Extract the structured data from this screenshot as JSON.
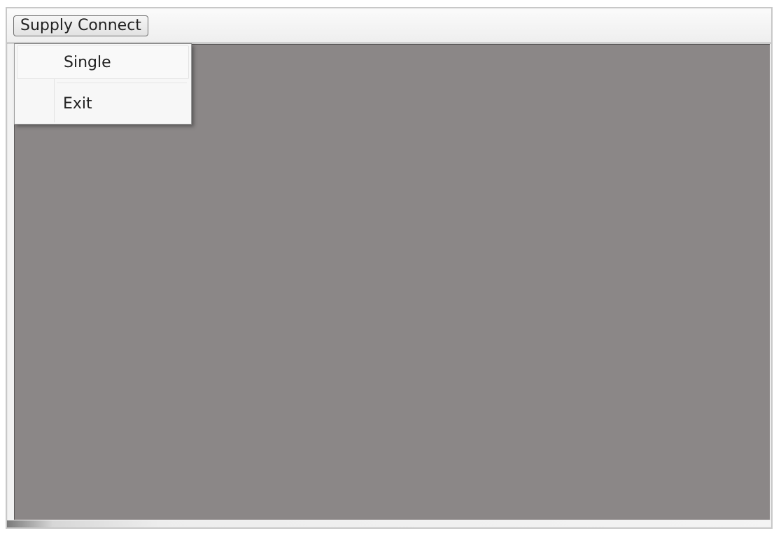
{
  "menubar": {
    "menu_title": "Supply Connect"
  },
  "dropdown": {
    "items": [
      {
        "label": "Single"
      },
      {
        "label": "Exit"
      }
    ]
  },
  "colors": {
    "client_background": "#8b8787",
    "menu_background": "#f7f7f7"
  }
}
